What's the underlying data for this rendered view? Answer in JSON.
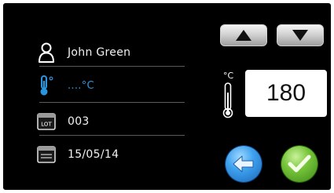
{
  "user": {
    "name": "John Green"
  },
  "temperature": {
    "value_text": "....°C"
  },
  "lot": {
    "value": "003"
  },
  "date": {
    "value": "15/05/14"
  },
  "setpoint": {
    "unit": "°C",
    "value": "180"
  },
  "colors": {
    "background": "#000000",
    "accent_blue": "#2a95df",
    "ok_green": "#77c43a",
    "text": "#f2f2f2"
  },
  "icons": {
    "user": "user-icon",
    "thermometer": "thermometer-icon",
    "lot": "lot-icon",
    "calendar": "calendar-icon",
    "up": "arrow-up-icon",
    "down": "arrow-down-icon",
    "back": "arrow-left-icon",
    "ok": "check-icon"
  }
}
